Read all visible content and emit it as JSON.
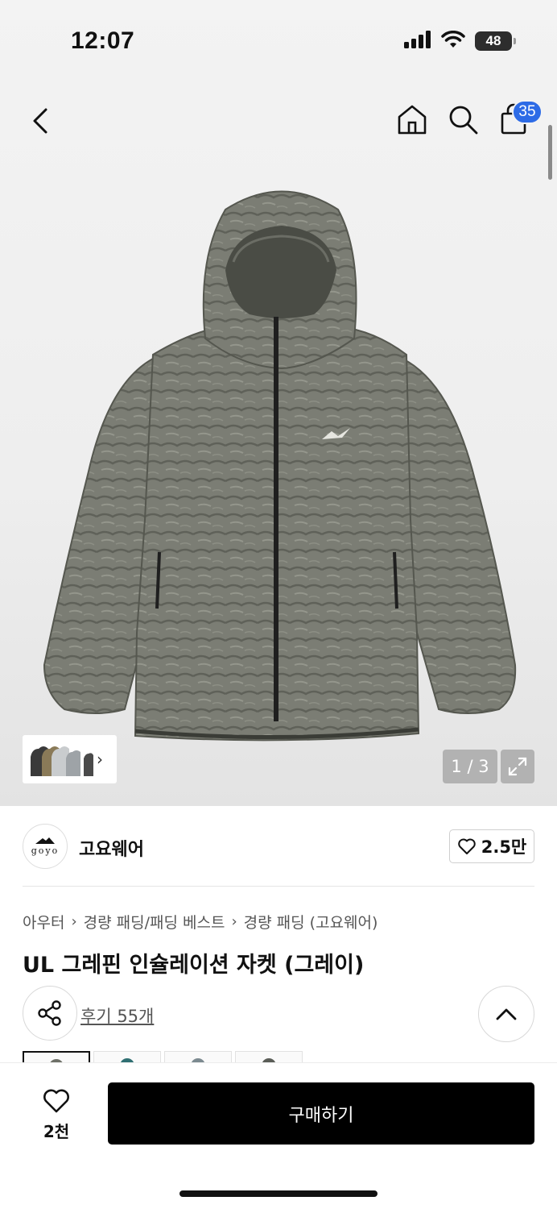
{
  "status_bar": {
    "time": "12:07",
    "battery": "48"
  },
  "header": {
    "cart_count": "35"
  },
  "gallery": {
    "page_indicator": "1 / 3"
  },
  "brand": {
    "logo_text": "goyo",
    "name": "고요웨어",
    "likes": "2.5만"
  },
  "breadcrumb": [
    "아우터",
    "경량 패딩/패딩 베스트",
    "경량 패딩 (고요웨어)"
  ],
  "product": {
    "title": "UL 그레핀 인슐레이션 자켓 (그레이)",
    "reviews": "후기 55개"
  },
  "variants": [
    "#6e7068",
    "#2f6f72",
    "#7c8a90",
    "#5a5d57"
  ],
  "bottom_bar": {
    "wish_count": "2천",
    "buy_label": "구매하기"
  },
  "colors": {
    "accent_badge": "#2d6be6",
    "buy_button": "#000000",
    "jacket": "#7a7c73"
  }
}
